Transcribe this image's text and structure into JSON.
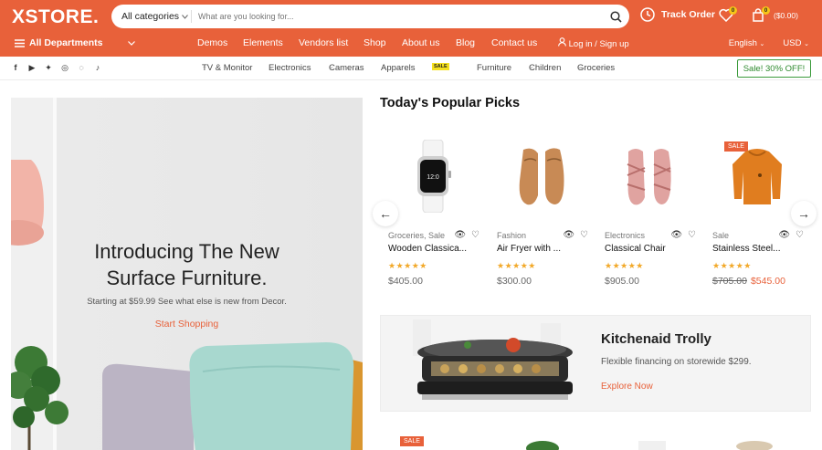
{
  "header": {
    "logo": "XSTORE.",
    "search": {
      "category": "All categories",
      "placeholder": "What are you looking for..."
    },
    "track_order": "Track Order",
    "wishlist_count": "0",
    "cart_count": "0",
    "cart_total": "($0.00)"
  },
  "nav": {
    "all_departments": "All Departments",
    "links": [
      "Demos",
      "Elements",
      "Vendors list",
      "Shop",
      "About us",
      "Blog",
      "Contact us"
    ],
    "login": "Log in / Sign up",
    "language": "English",
    "currency": "USD"
  },
  "subnav": {
    "categories": [
      "TV & Monitor",
      "Electronics",
      "Cameras",
      "Apparels",
      "Sale",
      "Furniture",
      "Children",
      "Groceries"
    ],
    "sale_tag": "SALE",
    "sale_button": "Sale! 30% OFF!"
  },
  "hero": {
    "title_line1": "Introducing The New",
    "title_line2": "Surface Furniture.",
    "subtitle": "Starting at $59.99 See what else is new from Decor.",
    "cta": "Start Shopping"
  },
  "popular": {
    "title": "Today's Popular Picks",
    "products": [
      {
        "category": "Groceries, Sale",
        "name": "Wooden Classica...",
        "rating": 5,
        "price": "$405.00",
        "old_price": "",
        "sale": false
      },
      {
        "category": "Fashion",
        "name": "Air Fryer with ...",
        "rating": 5,
        "price": "$300.00",
        "old_price": "",
        "sale": false
      },
      {
        "category": "Electronics",
        "name": "Classical Chair",
        "rating": 5,
        "price": "$905.00",
        "old_price": "",
        "sale": false
      },
      {
        "category": "Sale",
        "name": "Stainless Steel...",
        "rating": 5,
        "price": "$545.00",
        "old_price": "$705.00",
        "sale": true
      }
    ],
    "sale_label": "SALE"
  },
  "promo": {
    "title": "Kitchenaid Trolly",
    "subtitle": "Flexible financing on storewide $299.",
    "cta": "Explore Now"
  },
  "bottom": {
    "sale_label": "SALE"
  },
  "colors": {
    "brand": "#e8613a",
    "star": "#f2a92a",
    "sale_green": "#2e8a2e"
  }
}
